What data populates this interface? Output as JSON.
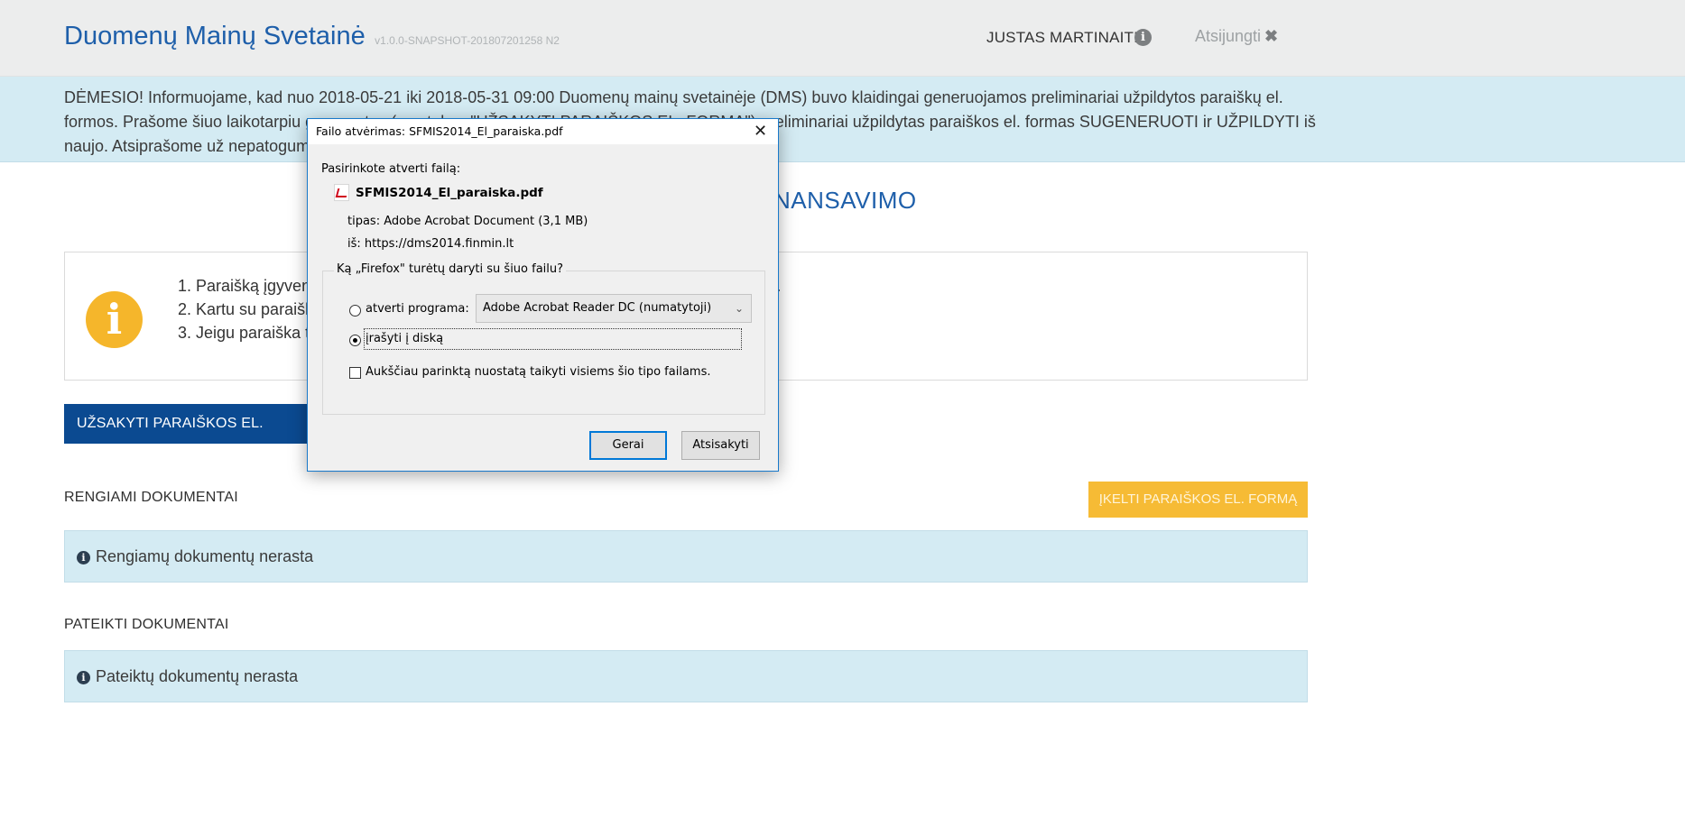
{
  "header": {
    "title": "Duomenų Mainų Svetainė",
    "version": "v1.0.0-SNAPSHOT-201807201258 N2",
    "user": "JUSTAS MARTINAITIS",
    "info_icon": "i",
    "logout_label": "Atsijungti",
    "logout_icon": "✖"
  },
  "notice": {
    "text": "DĖMESIO! Informuojame, kad nuo 2018-05-21 iki 2018-05-31 09:00 Duomenų mainų svetainėje (DMS) buvo klaidingai generuojamos preliminariai užpildytos paraiškų el. formos. Prašome šiuo laikotarpiu generuotas (mygtukas \"UŽSAKYTI PARAIŠKOS EL. FORMĄ\") preliminariai užpildytas paraiškos el. formas SUGENERUOTI ir UŽPILDYTI iš naujo. Atsiprašome už nepatogumus."
  },
  "page": {
    "heading_visible": "NANSAVIMO"
  },
  "rules": {
    "line1": "1. Paraišką įgyvend                                                                                                                    lbime ar valstybės ar regionų projektų sąraše nustatyto termino.",
    "line2": "2. Kartu su paraišk                                                                                                                        arba) kitus paraiškos priedus.",
    "line3": "3. Jeigu paraiška te                                                                                                                       kiekvieno partnerio pasirašyta deklaracija.",
    "icon": "i"
  },
  "buttons": {
    "order_form": "UŽSAKYTI PARAIŠKOS EL. FORMĄ",
    "upload_form": "ĮKELTI PARAIŠKOS EL. FORMĄ"
  },
  "sections": {
    "draft_title": "RENGIAMI DOKUMENTAI",
    "draft_empty": "Rengiamų dokumentų nerasta",
    "submitted_title": "PATEIKTI DOKUMENTAI",
    "submitted_empty": "Pateiktų dokumentų nerasta",
    "empty_icon": "i"
  },
  "dialog": {
    "title": "Failo atvėrimas: SFMIS2014_El_paraiska.pdf",
    "close_icon": "✕",
    "prompt": "Pasirinkote atverti failą:",
    "filename": "SFMIS2014_El_paraiska.pdf",
    "type_line": "tipas:  Adobe Acrobat Document (3,1 MB)",
    "from_line": "iš:  https://dms2014.finmin.lt",
    "question": "Ką „Firefox\" turėtų daryti su šiuo failu?",
    "open_with_label": "atverti programa:",
    "open_with_value": "Adobe Acrobat Reader DC  (numatytoji)",
    "save_label": "įrašyti į diską",
    "remember_label": "Aukščiau parinktą nuostatą taikyti visiems šio tipo failams.",
    "ok_label": "Gerai",
    "cancel_label": "Atsisakyti",
    "selected_option": "save",
    "remember_checked": false
  }
}
